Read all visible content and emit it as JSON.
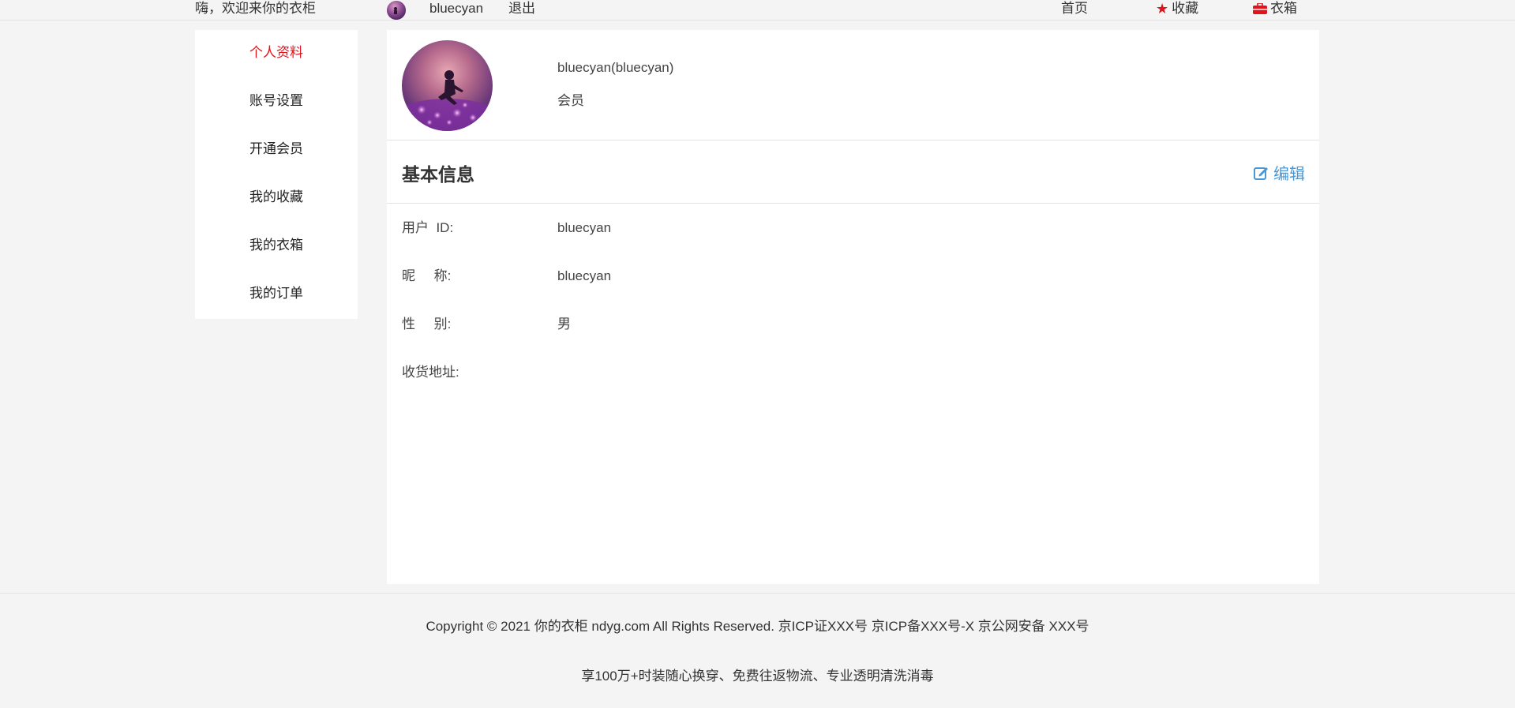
{
  "topbar": {
    "welcome": "嗨，欢迎来你的衣柜",
    "username": "bluecyan",
    "logout": "退出",
    "nav_home": "首页",
    "nav_favorites": "收藏",
    "nav_wardrobe": "衣箱"
  },
  "sidebar": {
    "items": [
      {
        "label": "个人资料"
      },
      {
        "label": "账号设置"
      },
      {
        "label": "开通会员"
      },
      {
        "label": "我的收藏"
      },
      {
        "label": "我的衣箱"
      },
      {
        "label": "我的订单"
      }
    ]
  },
  "profile": {
    "display_name": "bluecyan(bluecyan)",
    "level": "会员"
  },
  "section": {
    "title": "基本信息",
    "edit_label": "编辑"
  },
  "info": {
    "rows": [
      {
        "label": "用户  ID:",
        "value": "bluecyan"
      },
      {
        "label": "昵     称:",
        "value": "bluecyan"
      },
      {
        "label": "性     别:",
        "value": "男"
      },
      {
        "label": "收货地址:",
        "value": ""
      }
    ]
  },
  "footer": {
    "copyright": "Copyright © 2021 你的衣柜 ndyg.com All Rights Reserved. 京ICP证XXX号 京ICP备XXX号-X 京公网安备 XXX号",
    "slogan": "享100万+时装随心换穿、免费往返物流、专业透明清洗消毒"
  },
  "colors": {
    "accent_red": "#e0141e",
    "link_blue": "#4a97d6",
    "background": "#f4f4f4"
  }
}
